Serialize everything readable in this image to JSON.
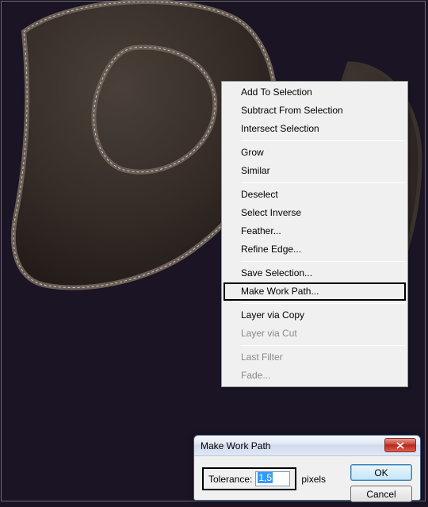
{
  "context_menu": {
    "items": [
      {
        "label": "Add To Selection",
        "enabled": true
      },
      {
        "label": "Subtract From Selection",
        "enabled": true
      },
      {
        "label": "Intersect Selection",
        "enabled": true
      }
    ],
    "group2": [
      {
        "label": "Grow",
        "enabled": true
      },
      {
        "label": "Similar",
        "enabled": true
      }
    ],
    "group3": [
      {
        "label": "Deselect",
        "enabled": true
      },
      {
        "label": "Select Inverse",
        "enabled": true
      },
      {
        "label": "Feather...",
        "enabled": true
      },
      {
        "label": "Refine Edge...",
        "enabled": true
      }
    ],
    "group4": [
      {
        "label": "Save Selection...",
        "enabled": true
      },
      {
        "label": "Make Work Path...",
        "enabled": true,
        "highlighted": true
      }
    ],
    "group5": [
      {
        "label": "Layer via Copy",
        "enabled": true
      },
      {
        "label": "Layer via Cut",
        "enabled": false
      }
    ],
    "group6": [
      {
        "label": "Last Filter",
        "enabled": false
      },
      {
        "label": "Fade...",
        "enabled": false
      }
    ]
  },
  "dialog": {
    "title": "Make Work Path",
    "tolerance_label": "Tolerance:",
    "tolerance_value": "1,5",
    "tolerance_unit": "pixels",
    "ok_label": "OK",
    "cancel_label": "Cancel"
  }
}
